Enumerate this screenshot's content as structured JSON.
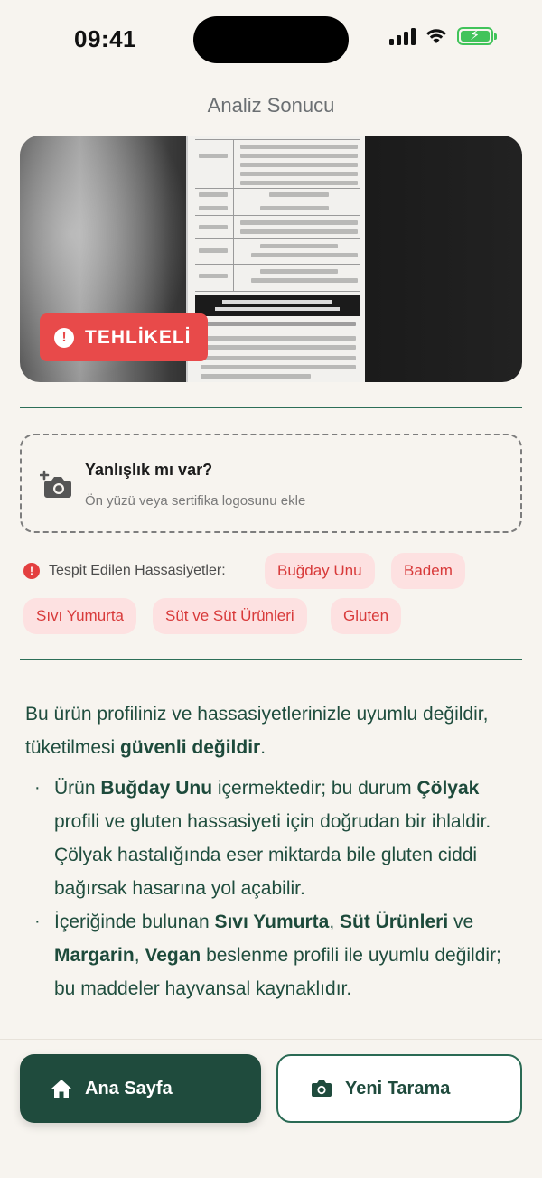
{
  "status": {
    "time": "09:41"
  },
  "header": {
    "title": "Analiz Sonucu"
  },
  "product": {
    "badge": "TEHLİKELİ",
    "badge_color": "#e84a4a"
  },
  "add_photo": {
    "title": "Yanlışlık mı var?",
    "subtitle": "Ön yüzü veya sertifika logosunu ekle"
  },
  "sensitivities": {
    "label": "Tespit Edilen Hassasiyetler:",
    "items": [
      "Buğday Unu",
      "Badem",
      "Sıvı Yumurta",
      "Süt ve Süt Ürünleri",
      "Gluten"
    ]
  },
  "analysis": {
    "intro_1": "Bu ürün profiliniz ve hassasiyetlerinizle uyumlu değildir, tüketilmesi ",
    "intro_bold": "güvenli değildir",
    "intro_2": ".",
    "b1_1": "Ürün ",
    "b1_bold1": "Buğday Unu",
    "b1_2": " içermektedir; bu durum ",
    "b1_bold2": "Çölyak",
    "b1_3": " profili ve gluten hassasiyeti için doğrudan bir ihlaldir. Çölyak hastalığında eser miktarda bile gluten ciddi bağırsak hasarına yol açabilir.",
    "b2_1": "İçeriğinde bulunan ",
    "b2_bold1": "Sıvı Yumurta",
    "b2_2": ", ",
    "b2_bold2": "Süt Ürünleri",
    "b2_3": " ve ",
    "b2_bold3": "Margarin",
    "b2_4": ", ",
    "b2_bold4": "Vegan",
    "b2_5": " beslenme profili ile uyumlu değildir; bu maddeler hayvansal kaynaklıdır."
  },
  "bottom": {
    "home_label": "Ana Sayfa",
    "scan_label": "Yeni Tarama"
  },
  "colors": {
    "primary": "#1f4b3d",
    "danger": "#e84a4a",
    "chip_bg": "#fde1e1",
    "background": "#f7f4ef"
  },
  "icons": [
    "signal-icon",
    "wifi-icon",
    "battery-icon",
    "alert-icon",
    "add-photo-icon",
    "home-icon",
    "camera-icon"
  ]
}
